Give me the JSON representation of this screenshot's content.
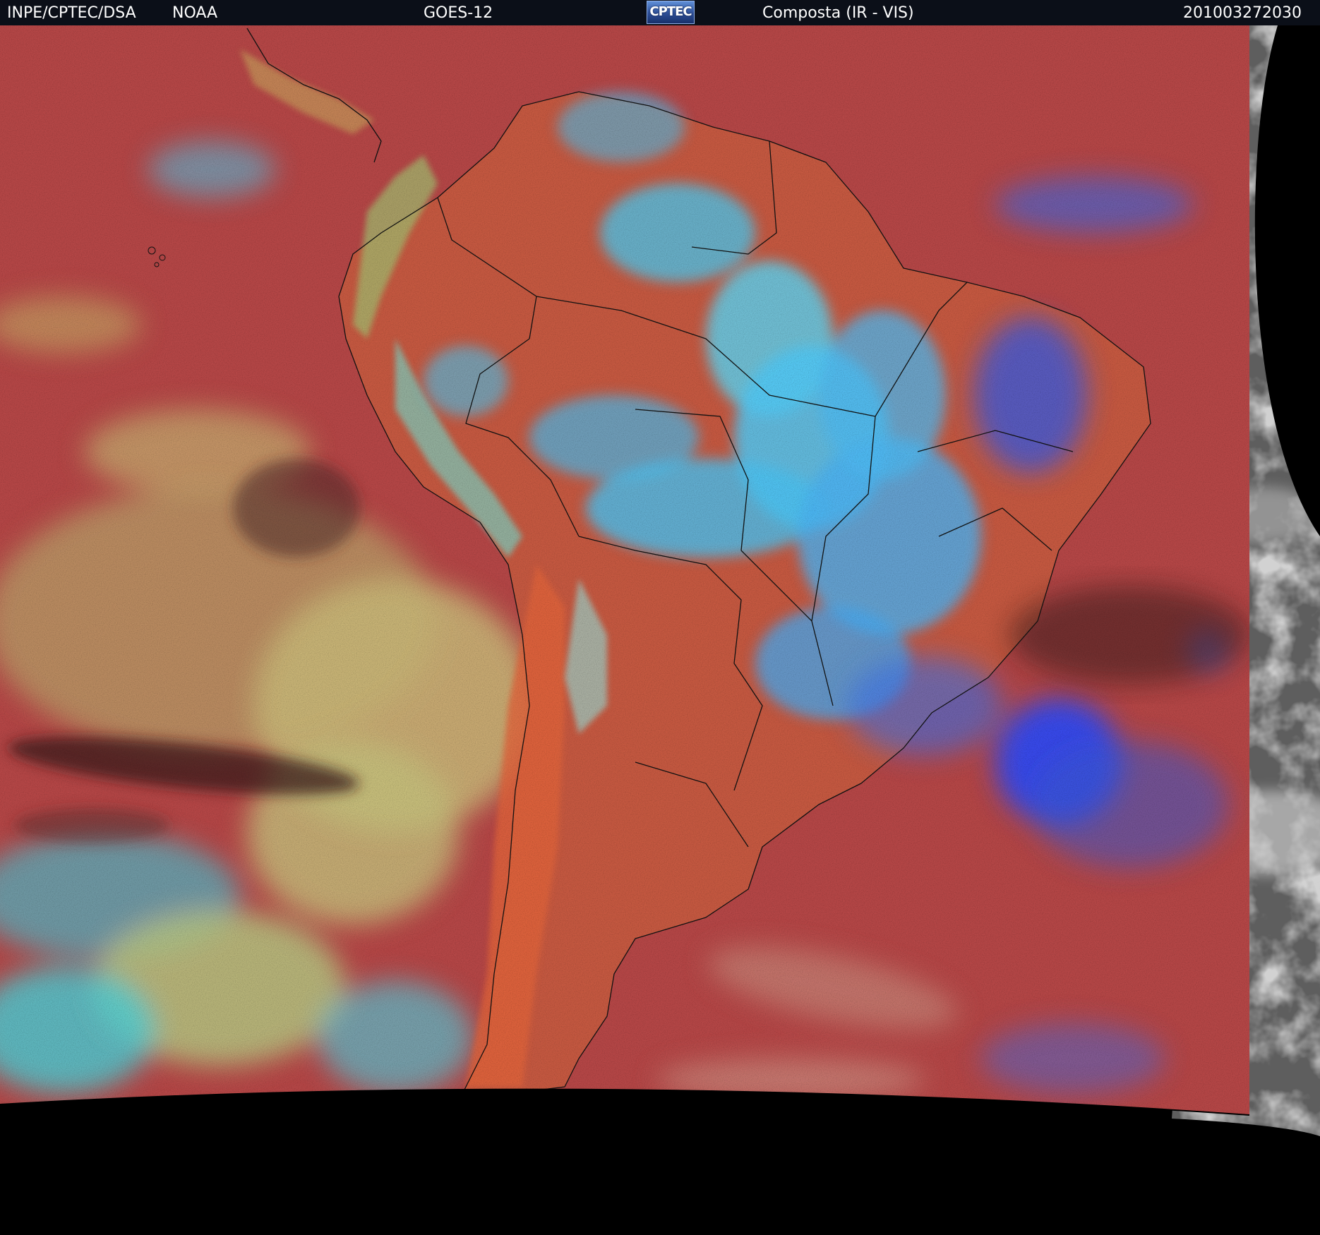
{
  "header": {
    "agency": "INPE/CPTEC/DSA",
    "provider": "NOAA",
    "satellite": "GOES-12",
    "logo_text": "CPTEC",
    "product": "Composta (IR - VIS)",
    "timestamp": "201003272030"
  },
  "colors": {
    "header_bg": "#0b0f18",
    "clear_sky": "#b84848",
    "land_clear": "#c85a40",
    "low_cloud": "#c8c070",
    "high_cloud": "#40c0ff",
    "deep_convection": "#2850ff",
    "visible_channel_gray": "#6a6a6a",
    "no_data": "#000000"
  }
}
